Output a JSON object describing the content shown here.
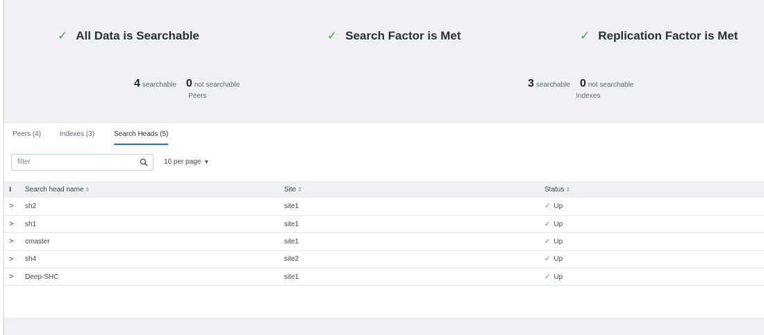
{
  "status": [
    {
      "label": "All Data is Searchable",
      "icon": "check-icon"
    },
    {
      "label": "Search Factor is Met",
      "icon": "check-icon"
    },
    {
      "label": "Replication Factor is Met",
      "icon": "check-icon"
    }
  ],
  "counts": [
    {
      "searchable_num": "4",
      "searchable_label": "searchable",
      "not_num": "0",
      "not_label": "not searchable",
      "caption": "Peers"
    },
    {
      "searchable_num": "3",
      "searchable_label": "searchable",
      "not_num": "0",
      "not_label": "not searchable",
      "caption": "Indexes"
    }
  ],
  "tabs": [
    {
      "label": "Peers (4)"
    },
    {
      "label": "Indexes (3)"
    },
    {
      "label": "Search Heads (5)",
      "active": true
    }
  ],
  "filter": {
    "placeholder": "filter",
    "value": ""
  },
  "per_page": {
    "label": "10 per page"
  },
  "table": {
    "info_header": "i",
    "headers": [
      "Search head name",
      "Site",
      "Status"
    ],
    "rows": [
      {
        "name": "sh2",
        "site": "site1",
        "status": "Up"
      },
      {
        "name": "sh1",
        "site": "site1",
        "status": "Up"
      },
      {
        "name": "cmaster",
        "site": "site1",
        "status": "Up"
      },
      {
        "name": "sh4",
        "site": "site2",
        "status": "Up"
      },
      {
        "name": "Deep-SHC",
        "site": "site1",
        "status": "Up"
      }
    ]
  },
  "colors": {
    "accent": "#1a73c8",
    "ok": "#4aa84a",
    "background": "#eef0f3"
  }
}
